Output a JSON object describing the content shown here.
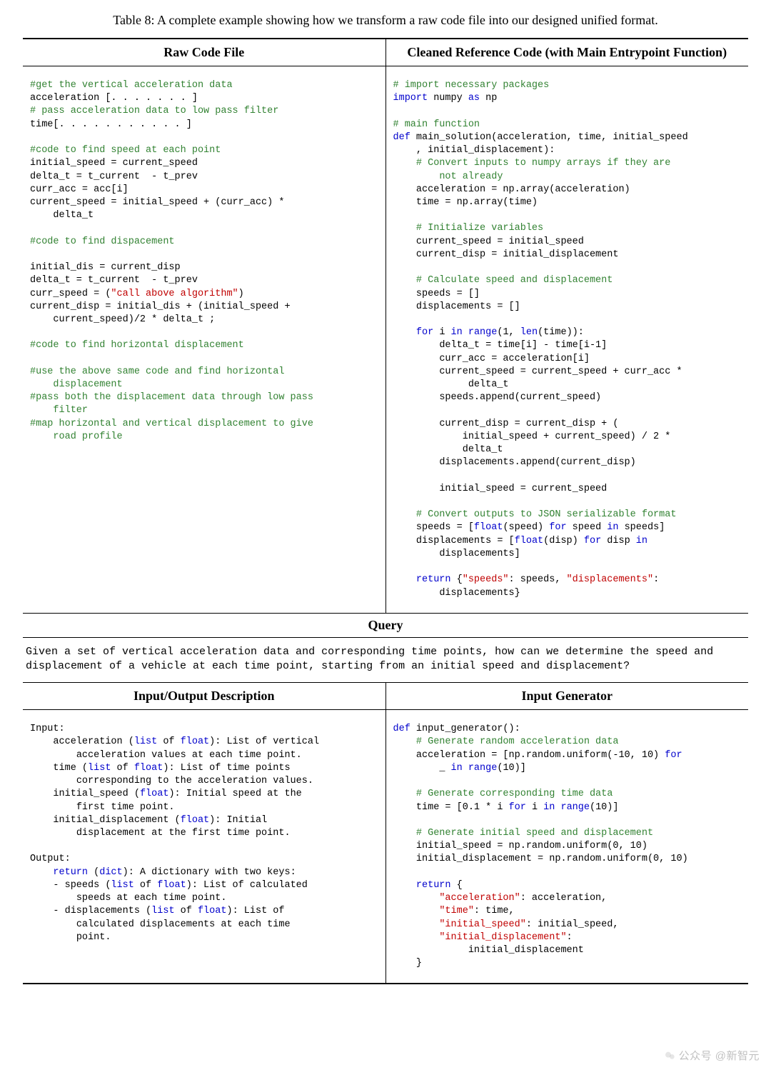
{
  "caption": "Table 8: A complete example showing how we transform a raw code file into our designed unified format.",
  "headers": {
    "col1": "Raw Code File",
    "col2": "Cleaned Reference Code (with Main Entrypoint Function)",
    "col3": "Input/Output Description",
    "col4": "Input Generator"
  },
  "query_label": "Query",
  "query_text": "Given a set of vertical acceleration data and corresponding time points, how can we determine the speed and displacement of a vehicle at each time point, starting from an initial speed and displacement?",
  "raw_code": {
    "l01": "#get the vertical acceleration data",
    "l02": "acceleration [. . . . . . . ]",
    "l03": "# pass acceleration data to low pass filter",
    "l04": "time[. . . . . . . . . . . ]",
    "l05": "#code to find speed at each point",
    "l06": "initial_speed = current_speed",
    "l07": "delta_t = t_current  - t_prev",
    "l08": "curr_acc = acc[i]",
    "l09a": "current_speed = initial_speed + (curr_acc) *",
    "l09b": "    delta_t",
    "l10": "#code to find dispacement",
    "l11": "initial_dis = current_disp",
    "l12": "delta_t = t_current  - t_prev",
    "l13a": "curr_speed = (",
    "l13b": "\"call above algorithm\"",
    "l13c": ")",
    "l14a": "current_disp = initial_dis + (initial_speed +",
    "l14b": "    current_speed)/2 * delta_t ;",
    "l15": "#code to find horizontal displacement",
    "l16a": "#use the above same code and find horizontal",
    "l16b": "    displacement",
    "l17a": "#pass both the displacement data through low pass",
    "l17b": "    filter",
    "l18a": "#map horizontal and vertical displacement to give",
    "l18b": "    road profile"
  },
  "clean_code": {
    "c01": "# import necessary packages",
    "c02a": "import",
    "c02b": " numpy ",
    "c02c": "as",
    "c02d": " np",
    "c03": "# main function",
    "c04a": "def",
    "c04b": " main_solution(acceleration, time, initial_speed",
    "c04c": "    , initial_displacement):",
    "c05a": "    # Convert inputs to numpy arrays if they are",
    "c05b": "        not already",
    "c06": "    acceleration = np.array(acceleration)",
    "c07": "    time = np.array(time)",
    "c08": "    # Initialize variables",
    "c09": "    current_speed = initial_speed",
    "c10": "    current_disp = initial_displacement",
    "c11": "    # Calculate speed and displacement",
    "c12": "    speeds = []",
    "c13": "    displacements = []",
    "c14a": "    for",
    "c14b": " i ",
    "c14c": "in",
    "c14d": " ",
    "c14e": "range",
    "c14f": "(1, ",
    "c14g": "len",
    "c14h": "(time)):",
    "c15": "        delta_t = time[i] - time[i-1]",
    "c16": "        curr_acc = acceleration[i]",
    "c17a": "        current_speed = current_speed + curr_acc *",
    "c17b": "             delta_t",
    "c18": "        speeds.append(current_speed)",
    "c19a": "        current_disp = current_disp + (",
    "c19b": "            initial_speed + current_speed) / 2 *",
    "c19c": "            delta_t",
    "c20": "        displacements.append(current_disp)",
    "c21": "        initial_speed = current_speed",
    "c22": "    # Convert outputs to JSON serializable format",
    "c23a": "    speeds = [",
    "c23b": "float",
    "c23c": "(speed) ",
    "c23d": "for",
    "c23e": " speed ",
    "c23f": "in",
    "c23g": " speeds]",
    "c24a": "    displacements = [",
    "c24b": "float",
    "c24c": "(disp) ",
    "c24d": "for",
    "c24e": " disp ",
    "c24f": "in",
    "c24g": "        displacements]",
    "c25a": "    return",
    "c25b": " {",
    "c25c": "\"speeds\"",
    "c25d": ": speeds, ",
    "c25e": "\"displacements\"",
    "c25f": ":",
    "c25g": "        displacements}"
  },
  "io_desc": {
    "d00": "Input:",
    "d01a": "    acceleration (",
    "d01b": "list",
    "d01c": " of ",
    "d01d": "float",
    "d01e": "): List of vertical",
    "d01f": "        acceleration values at each time point.",
    "d02a": "    time (",
    "d02e": "): List of time points",
    "d02f": "        corresponding to the acceleration values.",
    "d03a": "    initial_speed (",
    "d03e": "): Initial speed at the",
    "d03f": "        first time point.",
    "d04a": "    initial_displacement (",
    "d04e": "): Initial",
    "d04f": "        displacement at the first time point.",
    "d10": "Output:",
    "d11a": "    return",
    "d11b": " (",
    "d11c": "dict",
    "d11d": "): A dictionary with two keys:",
    "d12a": "    - speeds (",
    "d12e": "): List of calculated",
    "d12f": "        speeds at each time point.",
    "d13a": "    - displacements (",
    "d13e": "): List of",
    "d13f": "        calculated displacements at each time",
    "d13g": "        point."
  },
  "generator": {
    "g01a": "def",
    "g01b": " input_generator():",
    "g02": "    # Generate random acceleration data",
    "g03a": "    acceleration = [np.random.uniform(-10, 10) ",
    "g03b": "for",
    "g03c": "        _ ",
    "g03d": "in",
    "g03e": " ",
    "g03f": "range",
    "g03g": "(10)]",
    "g04": "    # Generate corresponding time data",
    "g05a": "    time = [0.1 * i ",
    "g05b": "for",
    "g05c": " i ",
    "g05d": "in",
    "g05e": " ",
    "g05f": "range",
    "g05g": "(10)]",
    "g06": "    # Generate initial speed and displacement",
    "g07": "    initial_speed = np.random.uniform(0, 10)",
    "g08": "    initial_displacement = np.random.uniform(0, 10)",
    "g09a": "    return",
    "g09b": " {",
    "g10a": "        \"acceleration\"",
    "g10b": ": acceleration,",
    "g11a": "        \"time\"",
    "g11b": ": time,",
    "g12a": "        \"initial_speed\"",
    "g12b": ": initial_speed,",
    "g13a": "        \"initial_displacement\"",
    "g13b": ":",
    "g13c": "             initial_displacement",
    "g14": "    }"
  },
  "watermark": {
    "left": "公众号",
    "right": "@新智元"
  }
}
